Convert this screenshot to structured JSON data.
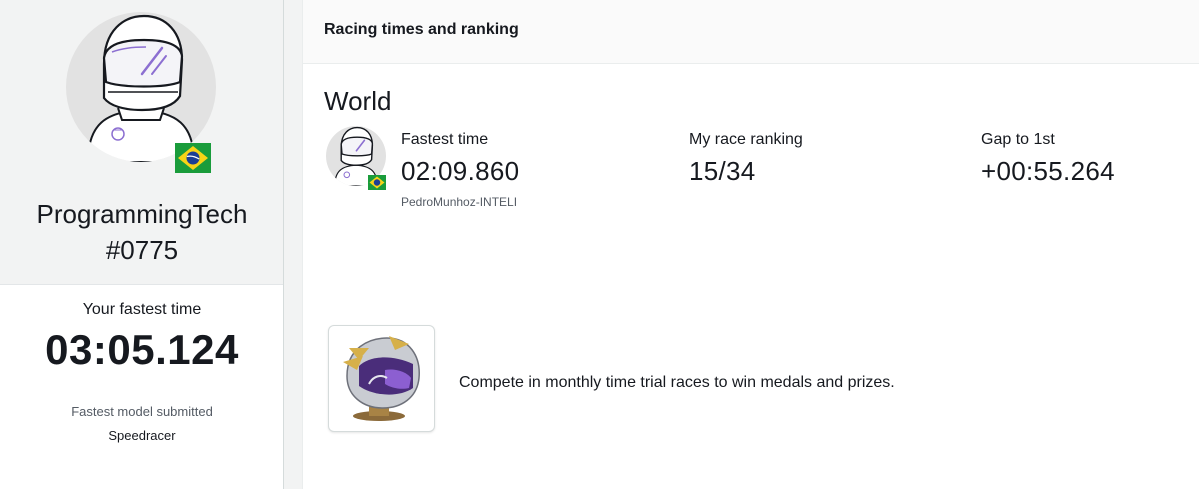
{
  "profile": {
    "name": "ProgrammingTech",
    "tag": "#0775",
    "country_flag": "brazil-flag",
    "fastest_label": "Your fastest time",
    "fastest_time": "03:05.124",
    "model_label": "Fastest model submitted",
    "model_name": "Speedracer"
  },
  "panel": {
    "header": "Racing times and ranking",
    "section_title": "World",
    "leader": {
      "fastest_label": "Fastest time",
      "fastest_time": "02:09.860",
      "leader_name": "PedroMunhoz-INTELI",
      "country_flag": "brazil-flag"
    },
    "ranking": {
      "label": "My race ranking",
      "value": "15/34"
    },
    "gap": {
      "label": "Gap to 1st",
      "value": "+00:55.264"
    },
    "promo": {
      "icon": "medal-helmet-icon",
      "text": "Compete in monthly time trial races to win medals and prizes."
    }
  },
  "colors": {
    "background": "#f2f3f3",
    "text": "#16191f",
    "muted": "#545b64",
    "visor_purple": "#8c6fd1"
  }
}
